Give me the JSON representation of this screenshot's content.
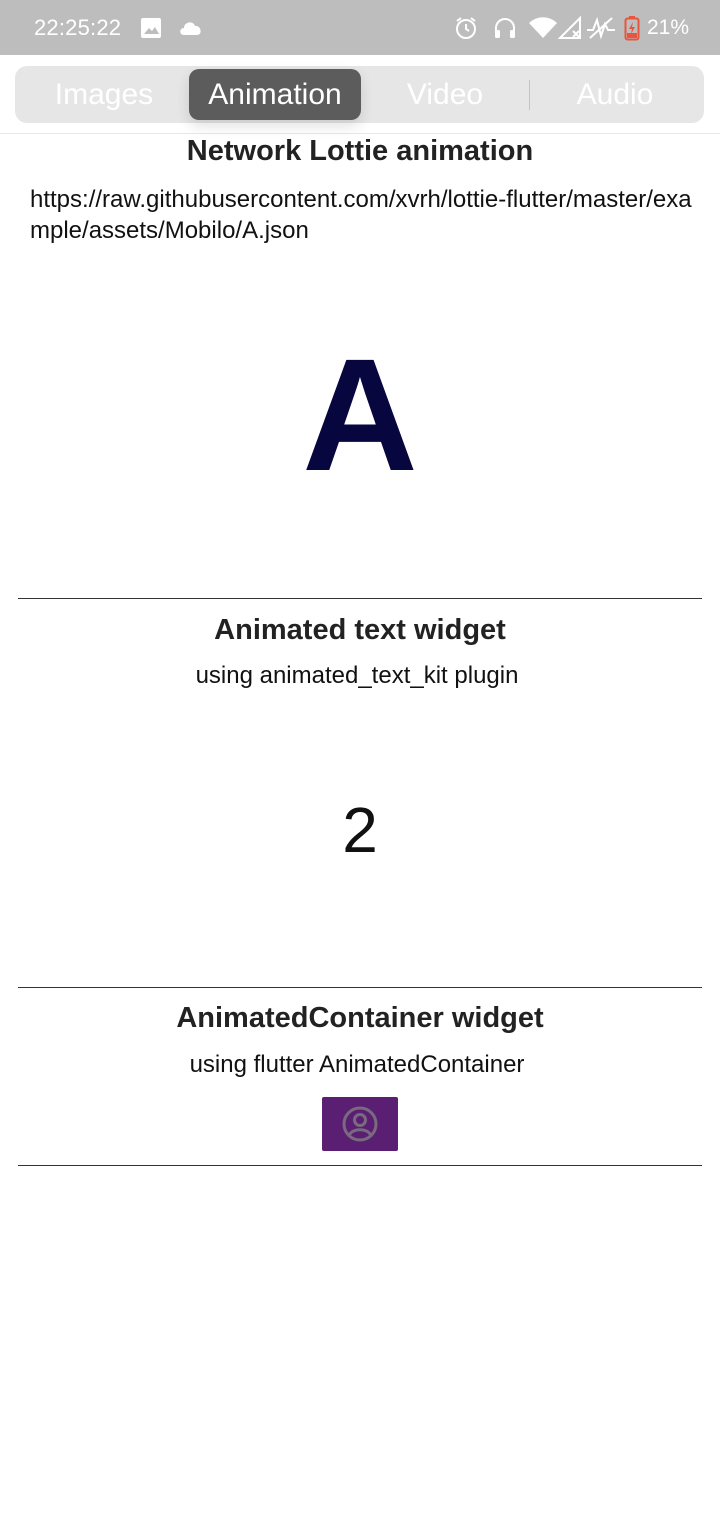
{
  "status_bar": {
    "time": "22:25:22",
    "battery": "21%",
    "icons": [
      "image-icon",
      "cloud-icon",
      "alarm-icon",
      "headphones-icon",
      "wifi-icon",
      "signal-icon",
      "activity-icon",
      "battery-charging-icon"
    ],
    "battery_color": "#e8553e"
  },
  "tabs": [
    {
      "label": "Images"
    },
    {
      "label": "Animation"
    },
    {
      "label": "Video"
    },
    {
      "label": "Audio"
    }
  ],
  "active_tab": "Animation",
  "sections": {
    "lottie": {
      "title": "Network Lottie animation",
      "url": "https://raw.githubusercontent.com/xvrh/lottie-flutter/master/example/assets/Mobilo/A.json",
      "letter": "A",
      "letter_color": "#07063e"
    },
    "animated_text": {
      "title": "Animated text widget",
      "subtitle": "using animated_text_kit plugin",
      "value": "2"
    },
    "animated_container": {
      "title": "AnimatedContainer widget",
      "subtitle": "using flutter AnimatedContainer",
      "icon": "account-circle-icon",
      "color": "#5a1f73"
    }
  }
}
